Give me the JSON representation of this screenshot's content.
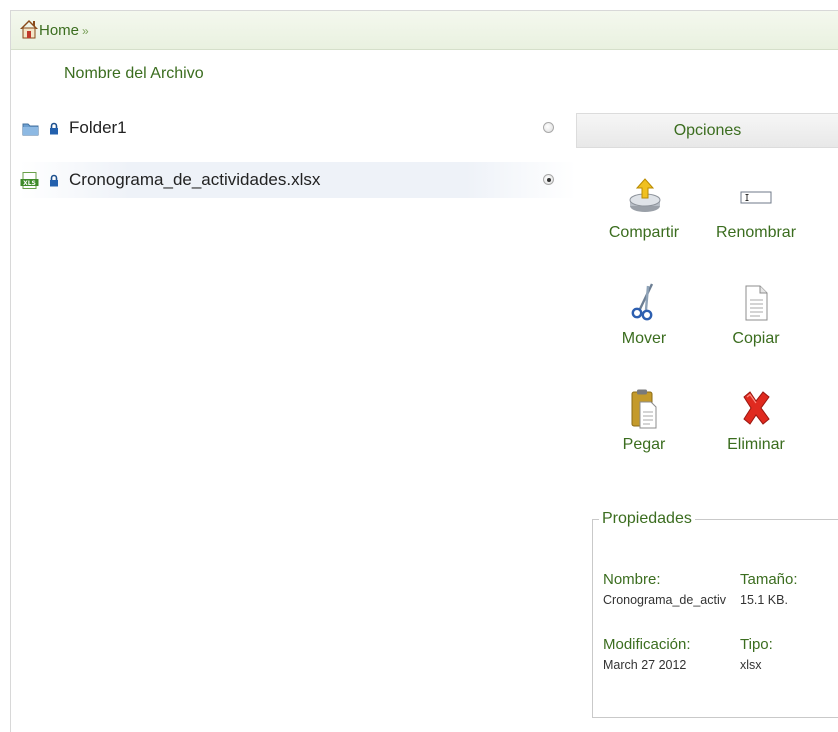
{
  "breadcrumb": {
    "home_label": "Home",
    "separator": "»"
  },
  "list": {
    "header": "Nombre del Archivo",
    "items": [
      {
        "name": "Folder1",
        "type_icon": "folder-icon",
        "selected": false
      },
      {
        "name": "Cronograma_de_actividades.xlsx",
        "type_icon": "xls-file-icon",
        "selected": true
      }
    ]
  },
  "options": {
    "title": "Opciones",
    "actions": [
      {
        "label": "Compartir",
        "icon": "share-icon"
      },
      {
        "label": "Renombrar",
        "icon": "rename-icon"
      },
      {
        "label": "Mover",
        "icon": "scissors-icon"
      },
      {
        "label": "Copiar",
        "icon": "copy-icon"
      },
      {
        "label": "Pegar",
        "icon": "paste-icon"
      },
      {
        "label": "Eliminar",
        "icon": "delete-icon"
      }
    ]
  },
  "properties": {
    "title": "Propiedades",
    "name_label": "Nombre:",
    "name_value": "Cronograma_de_activ",
    "size_label": "Tamaño:",
    "size_value": "15.1 KB.",
    "modified_label": "Modificación:",
    "modified_value": "March 27 2012",
    "type_label": "Tipo:",
    "type_value": "xlsx"
  },
  "colors": {
    "accent_text": "#3b6d1f",
    "breadcrumb_bg": "#eef4e6"
  }
}
